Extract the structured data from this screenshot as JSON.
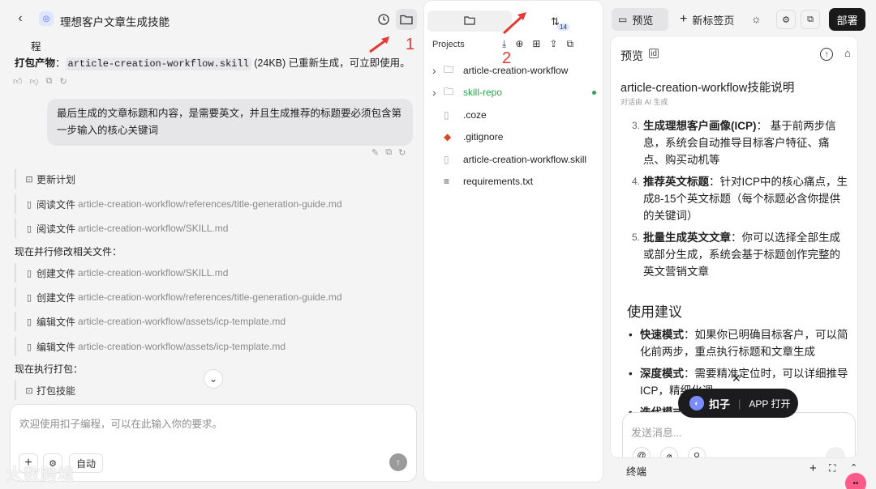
{
  "left": {
    "title": "理想客户文章生成技能",
    "partial_line": "程",
    "package_label": "打包产物",
    "package_colon": "：",
    "package_file": "article-creation-workflow.skill",
    "package_rest": " (24KB) 已重新生成，可立即使用。",
    "user_message": "最后生成的文章标题和内容，是需要英文，并且生成推荐的标题要必须包含第一步输入的核心关键词",
    "steps": [
      {
        "label": "更新计划",
        "path": ""
      },
      {
        "label": "阅读文件",
        "path": "article-creation-workflow/references/title-generation-guide.md"
      },
      {
        "label": "阅读文件",
        "path": "article-creation-workflow/SKILL.md"
      }
    ],
    "section_1": "现在并行修改相关文件：",
    "steps_2": [
      {
        "label": "创建文件",
        "path": "article-creation-workflow/SKILL.md"
      },
      {
        "label": "创建文件",
        "path": "article-creation-workflow/references/title-generation-guide.md"
      },
      {
        "label": "编辑文件",
        "path": "article-creation-workflow/assets/icp-template.md"
      },
      {
        "label": "编辑文件",
        "path": "article-creation-workflow/assets/icp-template.md"
      }
    ],
    "section_2": "现在执行打包：",
    "step_pack": "打包技能",
    "input_placeholder": "欢迎使用扣子编程，可以在此输入你的要求。",
    "mode_label": "自动",
    "annotation_1": "1",
    "watermark": "大数跨境"
  },
  "middle": {
    "badge_count": "14",
    "projects_label": "Projects",
    "annotation_2": "2",
    "tree": [
      {
        "name": "article-creation-workflow",
        "type": "folder",
        "expandable": true,
        "accent": false
      },
      {
        "name": "skill-repo",
        "type": "folder",
        "expandable": true,
        "accent": true
      },
      {
        "name": ".coze",
        "type": "file",
        "expandable": false,
        "accent": false
      },
      {
        "name": ".gitignore",
        "type": "git",
        "expandable": false,
        "accent": false
      },
      {
        "name": "article-creation-workflow.skill",
        "type": "file",
        "expandable": false,
        "accent": false
      },
      {
        "name": "requirements.txt",
        "type": "text",
        "expandable": false,
        "accent": false
      }
    ]
  },
  "right": {
    "tab_preview": "预览",
    "tab_new": "新标签页",
    "deploy_label": "部署",
    "preview_title": "预览",
    "doc_title": "article-creation-workflow技能说明",
    "doc_subtitle": "对话由 AI 生成",
    "items": [
      {
        "num": "3.",
        "bold": "生成理想客户画像(ICP)",
        "text": "： 基于前两步信息，系统会自动推导目标客户特征、痛点、购买动机等"
      },
      {
        "num": "4.",
        "bold": "推荐英文标题",
        "text": "：针对ICP中的核心痛点，生成8-15个英文标题（每个标题必含你提供的关键词）"
      },
      {
        "num": "5.",
        "bold": "批量生成英文文章",
        "text": "：你可以选择全部生成或部分生成，系统会基于标题创作完整的英文营销文章"
      }
    ],
    "section_heading": "使用建议",
    "bullets": [
      {
        "bold": "快速模式",
        "text": "：如果你已明确目标客户，可以简化前两步，重点执行标题和文章生成"
      },
      {
        "bold": "深度模式",
        "text": "：需要精准定位时，可以详细推导ICP，精细化调..."
      },
      {
        "bold": "迭代模式",
        "text": "..."
      }
    ],
    "toast_brand": "扣子",
    "toast_action": "APP 打开",
    "chat_placeholder": "发送消息...",
    "terminal_label": "终端"
  },
  "colors": {
    "accent_green": "#2ea44f",
    "annotation_red": "#e53935",
    "dark": "#1f1f1f"
  }
}
